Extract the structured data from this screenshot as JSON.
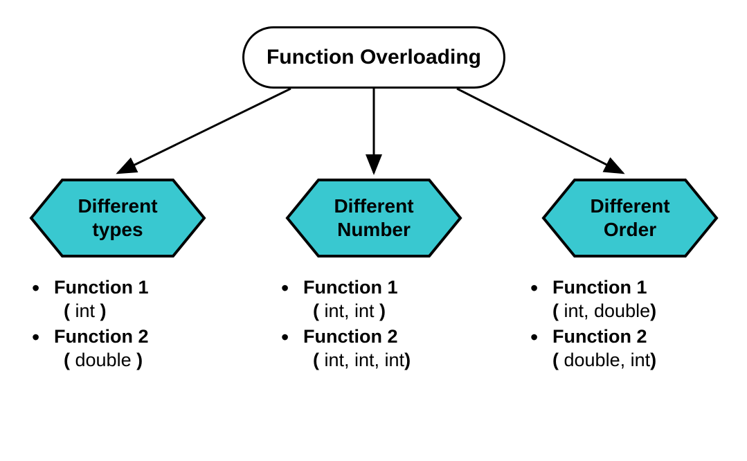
{
  "root": {
    "title": "Function Overloading"
  },
  "hexColor": "#39c8d0",
  "columns": [
    {
      "heading": "Different types",
      "items": [
        {
          "name": "Function 1",
          "params": "int"
        },
        {
          "name": "Function 2",
          "params": "double"
        }
      ]
    },
    {
      "heading": "Different Number",
      "items": [
        {
          "name": "Function 1",
          "params": "int, int"
        },
        {
          "name": "Function 2",
          "params": "int, int,  int"
        }
      ]
    },
    {
      "heading": "Different Order",
      "items": [
        {
          "name": "Function 1",
          "params": "int, double"
        },
        {
          "name": "Function 2",
          "params": "double, int"
        }
      ]
    }
  ]
}
